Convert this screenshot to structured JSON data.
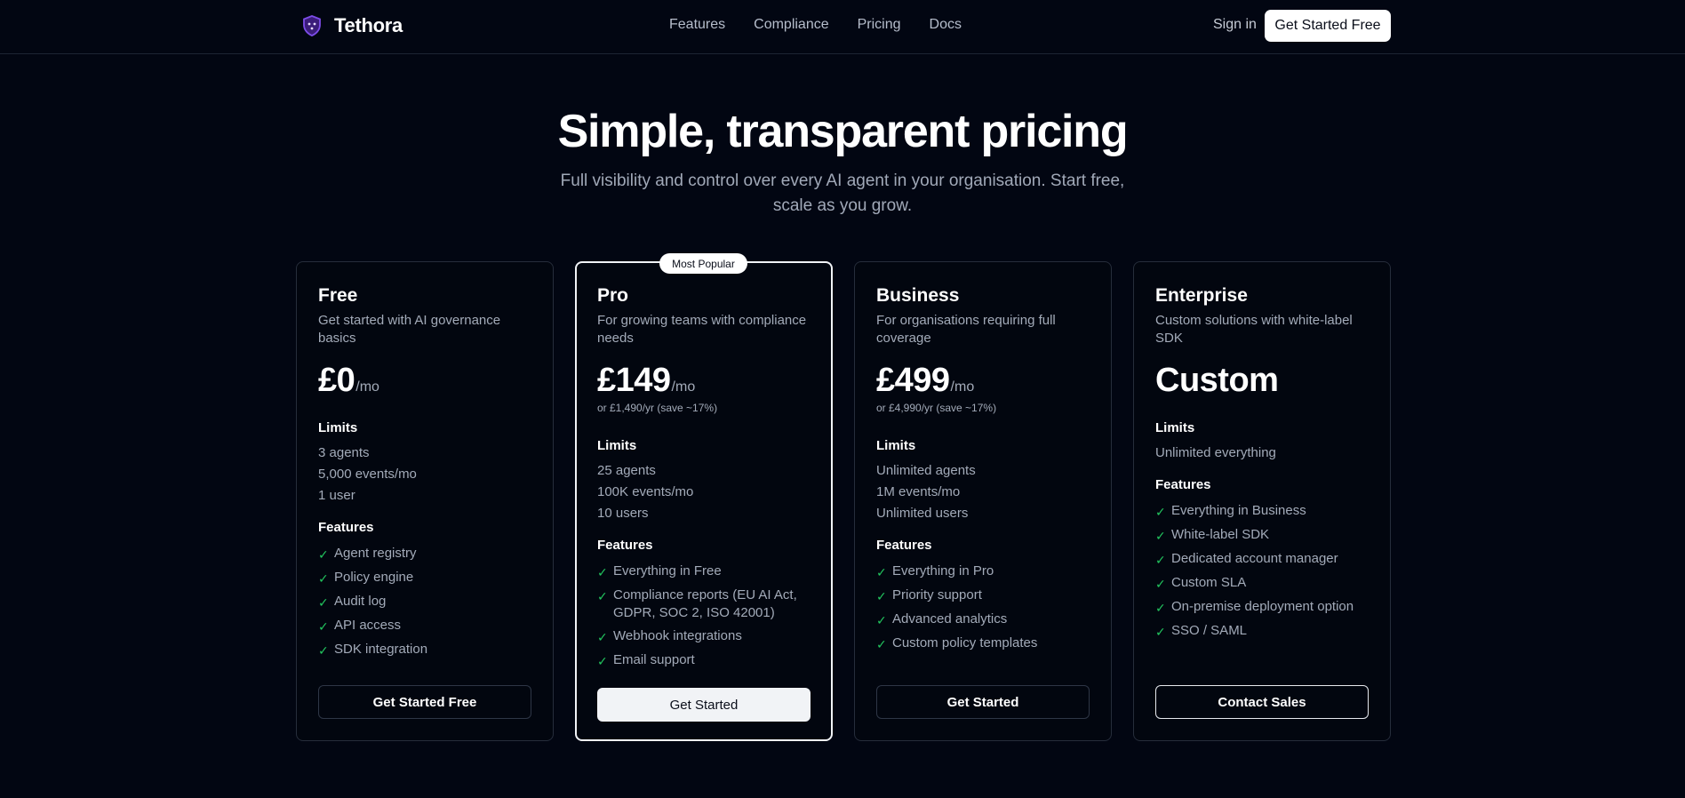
{
  "nav": {
    "brand": "Tethora",
    "links": [
      "Features",
      "Compliance",
      "Pricing",
      "Docs"
    ],
    "sign_in": "Sign in",
    "cta": "Get Started Free"
  },
  "hero": {
    "title": "Simple, transparent pricing",
    "subtitle": "Full visibility and control over every AI agent in your organisation. Start free, scale as you grow."
  },
  "plans": [
    {
      "name": "Free",
      "description": "Get started with AI governance basics",
      "price": "£0",
      "unit": "/mo",
      "limits_label": "Limits",
      "limits": [
        "3 agents",
        "5,000 events/mo",
        "1 user"
      ],
      "features_label": "Features",
      "features": [
        "Agent registry",
        "Policy engine",
        "Audit log",
        "API access",
        "SDK integration"
      ],
      "cta": "Get Started Free"
    },
    {
      "name": "Pro",
      "badge": "Most Popular",
      "description": "For growing teams with compliance needs",
      "price": "£149",
      "unit": "/mo",
      "annual": "or £1,490/yr (save ~17%)",
      "limits_label": "Limits",
      "limits": [
        "25 agents",
        "100K events/mo",
        "10 users"
      ],
      "features_label": "Features",
      "features": [
        "Everything in Free",
        "Compliance reports (EU AI Act, GDPR, SOC 2, ISO 42001)",
        "Webhook integrations",
        "Email support"
      ],
      "cta": "Get Started"
    },
    {
      "name": "Business",
      "description": "For organisations requiring full coverage",
      "price": "£499",
      "unit": "/mo",
      "annual": "or £4,990/yr (save ~17%)",
      "limits_label": "Limits",
      "limits": [
        "Unlimited agents",
        "1M events/mo",
        "Unlimited users"
      ],
      "features_label": "Features",
      "features": [
        "Everything in Pro",
        "Priority support",
        "Advanced analytics",
        "Custom policy templates"
      ],
      "cta": "Get Started"
    },
    {
      "name": "Enterprise",
      "description": "Custom solutions with white-label SDK",
      "price": "Custom",
      "limits_label": "Limits",
      "limits": [
        "Unlimited everything"
      ],
      "features_label": "Features",
      "features": [
        "Everything in Business",
        "White-label SDK",
        "Dedicated account manager",
        "Custom SLA",
        "On-premise deployment option",
        "SSO / SAML"
      ],
      "cta": "Contact Sales"
    }
  ],
  "icons": {
    "logo": "shield-icon",
    "check": "check-icon"
  },
  "colors": {
    "background": "#020612",
    "accent_check": "#22c55e",
    "logo": "#6d3fd9"
  }
}
